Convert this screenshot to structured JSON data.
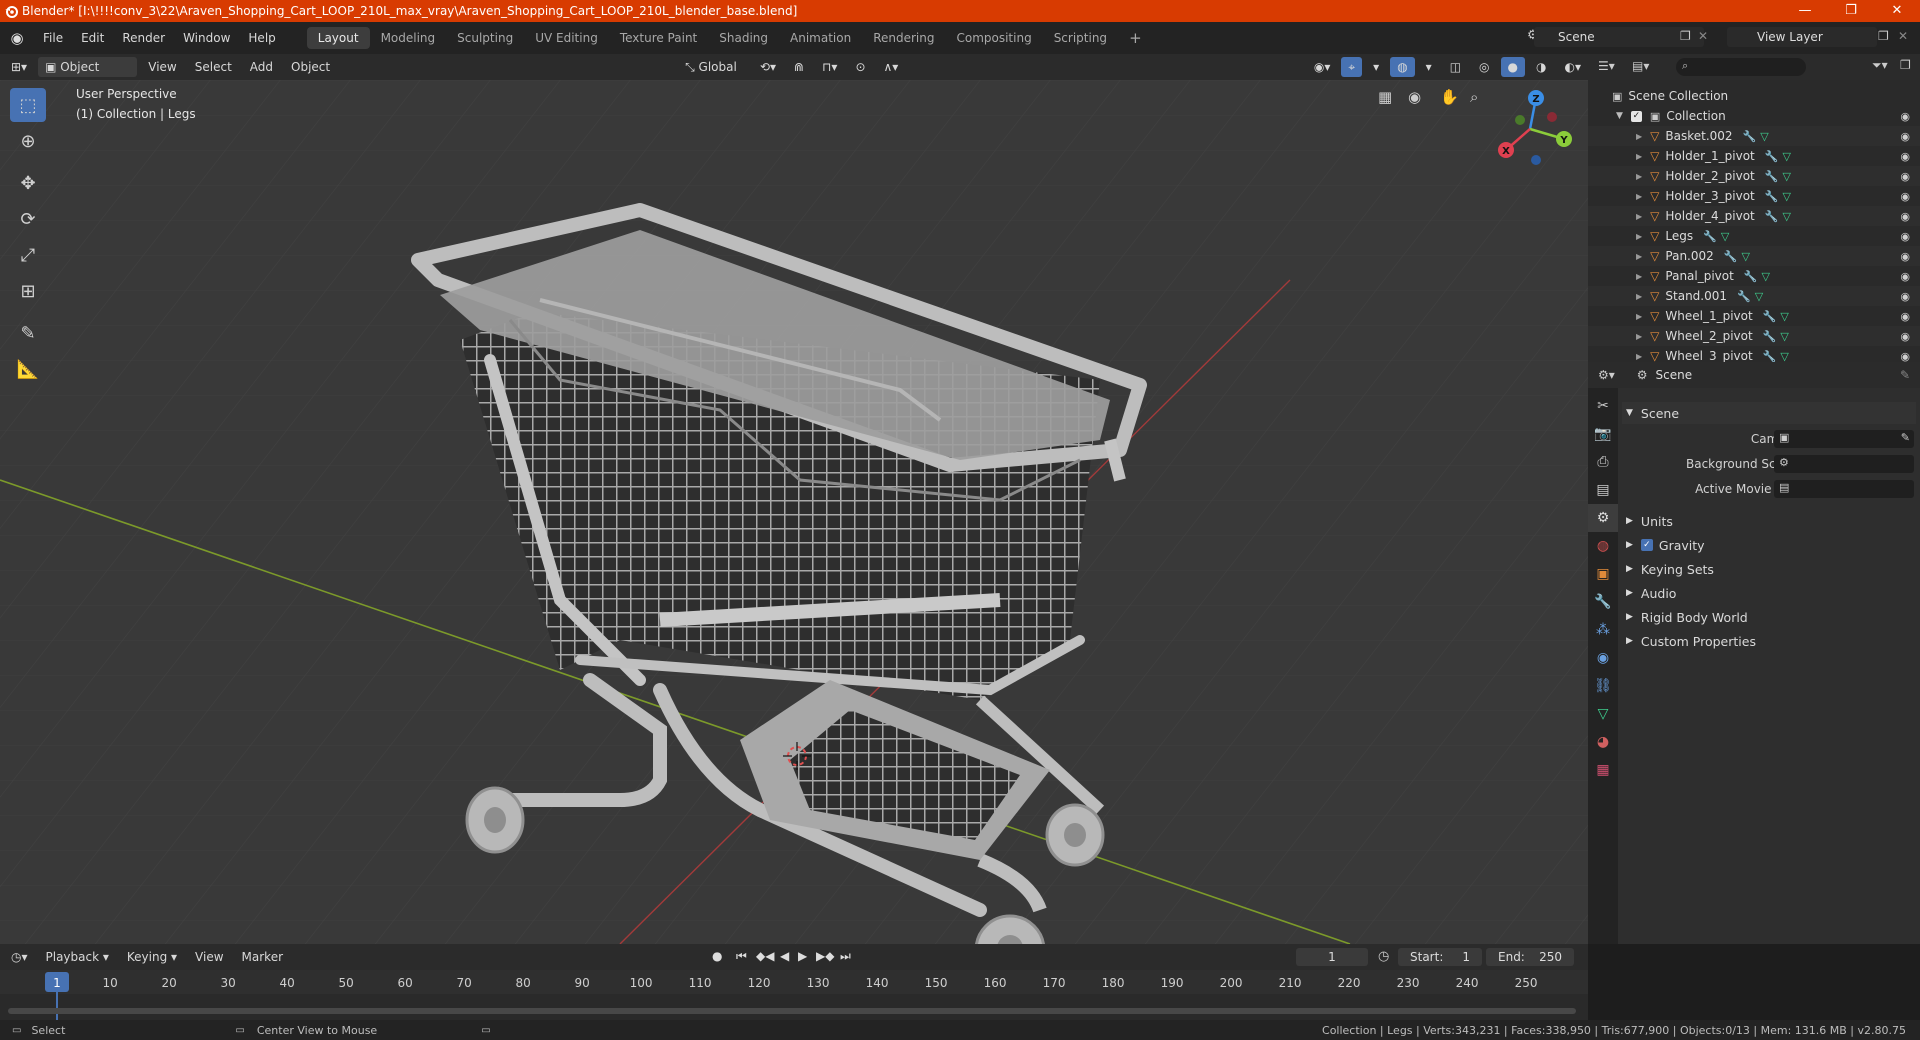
{
  "window": {
    "title": "Blender* [I:\\!!!!conv_3\\22\\Araven_Shopping_Cart_LOOP_210L_max_vray\\Araven_Shopping_Cart_LOOP_210L_blender_base.blend]",
    "minimize": "—",
    "maximize": "❐",
    "close": "✕"
  },
  "menubar": {
    "items": [
      "File",
      "Edit",
      "Render",
      "Window",
      "Help"
    ],
    "workspaces": [
      "Layout",
      "Modeling",
      "Sculpting",
      "UV Editing",
      "Texture Paint",
      "Shading",
      "Animation",
      "Rendering",
      "Compositing",
      "Scripting"
    ],
    "active_workspace": "Layout",
    "add_tab": "+",
    "scene": "Scene",
    "view_layer": "View Layer"
  },
  "viewport_header": {
    "mode": "Object Mode",
    "menus": [
      "View",
      "Select",
      "Add",
      "Object"
    ],
    "orientation": "Global"
  },
  "viewport": {
    "perspective": "User Perspective",
    "context": "(1) Collection | Legs",
    "gizmo": {
      "x": "X",
      "y": "Y",
      "z": "Z"
    }
  },
  "outliner": {
    "root": "Scene Collection",
    "collection": "Collection",
    "items": [
      "Basket.002",
      "Holder_1_pivot",
      "Holder_2_pivot",
      "Holder_3_pivot",
      "Holder_4_pivot",
      "Legs",
      "Pan.002",
      "Panal_pivot",
      "Stand.001",
      "Wheel_1_pivot",
      "Wheel_2_pivot",
      "Wheel_3_pivot"
    ]
  },
  "properties": {
    "context": "Scene",
    "panel_title": "Scene",
    "fields": {
      "camera": "Camera",
      "background_scene": "Background Scene",
      "active_movie_clip": "Active Movie Clip"
    },
    "subpanels": [
      "Units",
      "Gravity",
      "Keying Sets",
      "Audio",
      "Rigid Body World",
      "Custom Properties"
    ]
  },
  "timeline": {
    "menus": [
      "Playback",
      "Keying",
      "View",
      "Marker"
    ],
    "current_frame": "1",
    "start_label": "Start:",
    "start": "1",
    "end_label": "End:",
    "end": "250",
    "ruler": [
      "1",
      "10",
      "20",
      "30",
      "40",
      "50",
      "60",
      "70",
      "80",
      "90",
      "100",
      "110",
      "120",
      "130",
      "140",
      "150",
      "160",
      "170",
      "180",
      "190",
      "200",
      "210",
      "220",
      "230",
      "240",
      "250"
    ]
  },
  "statusbar": {
    "select": "Select",
    "center_view": "Center View to Mouse",
    "stats": "Collection | Legs | Verts:343,231 | Faces:338,950 | Tris:677,900 | Objects:0/13 | Mem: 131.6 MB | v2.80.75"
  },
  "colors": {
    "title_bar": "#d83b01",
    "accent": "#4772b3",
    "x_axis": "#e04050",
    "y_axis": "#8bcc3a",
    "z_axis": "#3a8ee6"
  }
}
